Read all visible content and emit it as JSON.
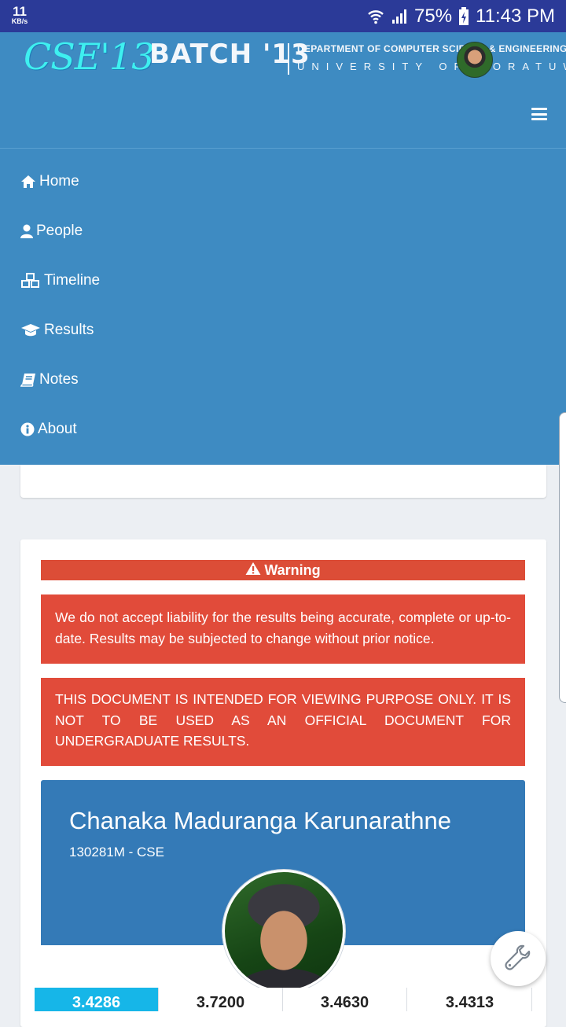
{
  "status_bar": {
    "net_speed": "11",
    "net_unit": "KB/s",
    "battery": "75%",
    "time": "11:43 PM"
  },
  "header": {
    "logo_cse": "CSE'13",
    "logo_batch": "BATCH '13",
    "dept_line": "DEPARTMENT OF COMPUTER SCIENCE & ENGINEERING",
    "uni_line": "UNIVERSITY OF MORATUWA"
  },
  "nav": {
    "items": [
      {
        "label": "Home",
        "icon": "home-icon"
      },
      {
        "label": "People",
        "icon": "user-icon"
      },
      {
        "label": "Timeline",
        "icon": "cubes-icon"
      },
      {
        "label": "Results",
        "icon": "graduation-cap-icon"
      },
      {
        "label": "Notes",
        "icon": "book-icon"
      },
      {
        "label": "About",
        "icon": "info-icon"
      }
    ]
  },
  "warning": {
    "title": "Warning",
    "message_1": "We do not accept liability for the results being accurate, complete or up-to-date. Results may be subjected to change without prior notice.",
    "message_2": "THIS DOCUMENT IS INTENDED FOR VIEWING PURPOSE ONLY. IT IS NOT TO BE USED AS AN OFFICIAL DOCUMENT FOR UNDERGRADUATE RESULTS."
  },
  "profile": {
    "name": "Chanaka Maduranga Karunarathne",
    "id_line": "130281M - CSE"
  },
  "stats": [
    "3.4286",
    "3.7200",
    "3.4630",
    "3.4313"
  ],
  "colors": {
    "header_bg": "#3e8bc2",
    "warning_bg": "#e14b3a",
    "profile_bg": "#347ab7",
    "active_stat": "#16b6e8"
  }
}
